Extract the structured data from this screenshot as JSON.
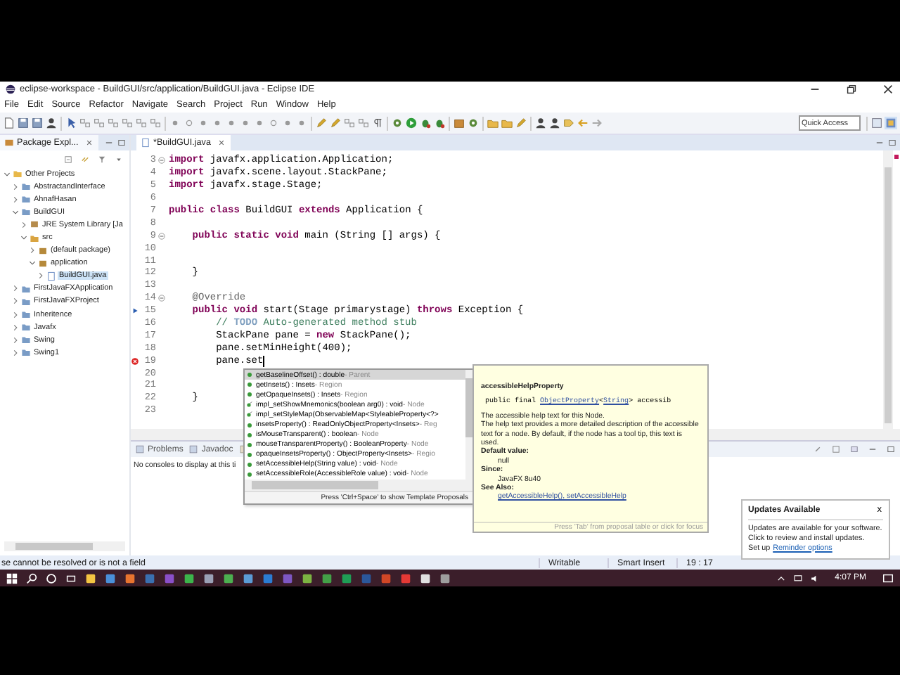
{
  "window": {
    "title": "eclipse-workspace - BuildGUI/src/application/BuildGUI.java - Eclipse IDE"
  },
  "menu": [
    "File",
    "Edit",
    "Source",
    "Refactor",
    "Navigate",
    "Search",
    "Project",
    "Run",
    "Window",
    "Help"
  ],
  "toolbar": {
    "quick_access": {
      "placeholder": "Quick Access"
    }
  },
  "package_explorer": {
    "tab": "Package Expl...",
    "tree": [
      {
        "label": "Other Projects",
        "kind": "folder",
        "expanded": true,
        "selected": false,
        "children": [
          {
            "label": "AbstractandInterface",
            "kind": "project",
            "expanded": false,
            "selected": false
          },
          {
            "label": "AhnafHasan",
            "kind": "project",
            "expanded": false,
            "selected": false
          },
          {
            "label": "BuildGUI",
            "kind": "project",
            "expanded": true,
            "selected": false,
            "children": [
              {
                "label": "JRE System Library [Ja",
                "kind": "library",
                "expanded": false,
                "selected": false
              },
              {
                "label": "src",
                "kind": "source",
                "expanded": true,
                "selected": false,
                "children": [
                  {
                    "label": "(default package)",
                    "kind": "package",
                    "expanded": false,
                    "selected": false
                  },
                  {
                    "label": "application",
                    "kind": "package",
                    "expanded": true,
                    "selected": false,
                    "children": [
                      {
                        "label": "BuildGUI.java",
                        "kind": "file",
                        "expanded": false,
                        "selected": true
                      }
                    ]
                  }
                ]
              }
            ]
          },
          {
            "label": "FirstJavaFXApplication",
            "kind": "project",
            "expanded": false,
            "selected": false
          },
          {
            "label": "FirstJavaFXProject",
            "kind": "project",
            "expanded": false,
            "selected": false
          },
          {
            "label": "Inheritence",
            "kind": "project",
            "expanded": false,
            "selected": false
          },
          {
            "label": "Javafx",
            "kind": "project",
            "expanded": false,
            "selected": false
          },
          {
            "label": "Swing",
            "kind": "project",
            "expanded": false,
            "selected": false
          },
          {
            "label": "Swing1",
            "kind": "project",
            "expanded": false,
            "selected": false
          }
        ]
      }
    ]
  },
  "editor": {
    "tab": "*BuildGUI.java",
    "lines": [
      {
        "number": "3",
        "kind": "fold",
        "segments": [
          {
            "kind": "keyword",
            "text": "import"
          },
          {
            "kind": "plain",
            "text": " javafx.application.Application;"
          }
        ]
      },
      {
        "number": "4",
        "kind": "plain",
        "segments": [
          {
            "kind": "keyword",
            "text": "import"
          },
          {
            "kind": "plain",
            "text": " javafx.scene.layout.StackPane;"
          }
        ]
      },
      {
        "number": "5",
        "kind": "plain",
        "segments": [
          {
            "kind": "keyword",
            "text": "import"
          },
          {
            "kind": "plain",
            "text": " javafx.stage.Stage;"
          }
        ]
      },
      {
        "number": "6",
        "kind": "plain"
      },
      {
        "number": "7",
        "kind": "plain",
        "segments": [
          {
            "kind": "keyword",
            "text": "public"
          },
          {
            "kind": "keyword",
            "text": " class"
          },
          {
            "kind": "plain",
            "text": " BuildGUI "
          },
          {
            "kind": "keyword",
            "text": "extends"
          },
          {
            "kind": "plain",
            "text": " Application {"
          }
        ]
      },
      {
        "number": "8",
        "kind": "plain"
      },
      {
        "number": "9",
        "kind": "fold",
        "segments": [
          {
            "kind": "keyword",
            "text": "    public"
          },
          {
            "kind": "keyword",
            "text": " static"
          },
          {
            "kind": "keyword",
            "text": " void"
          },
          {
            "kind": "plain",
            "text": " main (String [] args) {"
          }
        ]
      },
      {
        "number": "10",
        "kind": "plain"
      },
      {
        "number": "11",
        "kind": "plain"
      },
      {
        "number": "12",
        "kind": "plain",
        "segments": [
          {
            "kind": "plain",
            "text": "    }"
          }
        ]
      },
      {
        "number": "13",
        "kind": "plain"
      },
      {
        "number": "14",
        "kind": "fold",
        "segments": [
          {
            "kind": "annotation",
            "text": "    @Override"
          }
        ]
      },
      {
        "number": "15",
        "kind": "override",
        "segments": [
          {
            "kind": "keyword",
            "text": "    public"
          },
          {
            "kind": "keyword",
            "text": " void"
          },
          {
            "kind": "plain",
            "text": " start(Stage primarystage) "
          },
          {
            "kind": "keyword",
            "text": "throws"
          },
          {
            "kind": "plain",
            "text": " Exception {"
          }
        ]
      },
      {
        "number": "16",
        "kind": "plain",
        "segments": [
          {
            "kind": "comment",
            "text": "        // "
          },
          {
            "kind": "todo",
            "text": "TODO"
          },
          {
            "kind": "comment",
            "text": " Auto-generated method stub"
          }
        ]
      },
      {
        "number": "17",
        "kind": "plain",
        "segments": [
          {
            "kind": "plain",
            "text": "        StackPane pane = "
          },
          {
            "kind": "keyword",
            "text": "new"
          },
          {
            "kind": "plain",
            "text": " StackPane();"
          }
        ]
      },
      {
        "number": "18",
        "kind": "plain",
        "segments": [
          {
            "kind": "plain",
            "text": "        pane.setMinHeight(400);"
          }
        ]
      },
      {
        "number": "19",
        "kind": "error",
        "segments": [
          {
            "kind": "plain",
            "text": "        pane.set"
          }
        ]
      },
      {
        "number": "20",
        "kind": "plain"
      },
      {
        "number": "21",
        "kind": "plain"
      },
      {
        "number": "22",
        "kind": "plain",
        "segments": [
          {
            "kind": "plain",
            "text": "    }"
          }
        ]
      },
      {
        "number": "23",
        "kind": "plain"
      }
    ]
  },
  "console": {
    "tabs": [
      {
        "label": "Problems",
        "selected": false
      },
      {
        "label": "Javadoc",
        "selected": false
      }
    ],
    "message": "No consoles to display at this ti"
  },
  "completion": {
    "items": [
      {
        "signature": "getBaselineOffset() : double",
        "owner": " - Parent",
        "kind": "method",
        "selected": true
      },
      {
        "signature": "getInsets() : Insets",
        "owner": " - Region",
        "kind": "method",
        "selected": false
      },
      {
        "signature": "getOpaqueInsets() : Insets",
        "owner": " - Region",
        "kind": "method",
        "selected": false
      },
      {
        "signature": "impl_setShowMnemonics(boolean arg0) : void",
        "owner": " - Node",
        "kind": "deprecated",
        "selected": false
      },
      {
        "signature": "impl_setStyleMap(ObservableMap<StyleableProperty<?>",
        "kind": "deprecated",
        "selected": false
      },
      {
        "signature": "insetsProperty() : ReadOnlyObjectProperty<Insets>",
        "owner": " - Reg",
        "kind": "method",
        "selected": false
      },
      {
        "signature": "isMouseTransparent() : boolean",
        "owner": " - Node",
        "kind": "method",
        "selected": false
      },
      {
        "signature": "mouseTransparentProperty() : BooleanProperty",
        "owner": " - Node",
        "kind": "method",
        "selected": false
      },
      {
        "signature": "opaqueInsetsProperty() : ObjectProperty<Insets>",
        "owner": " - Regio",
        "kind": "method",
        "selected": false
      },
      {
        "signature": "setAccessibleHelp(String value) : void",
        "owner": " - Node",
        "kind": "method",
        "selected": false
      },
      {
        "signature": "setAccessibleRole(AccessibleRole value) : void",
        "owner": " - Node",
        "kind": "method",
        "selected": false
      }
    ],
    "footer": "Press 'Ctrl+Space' to show Template Proposals"
  },
  "javadoc": {
    "title": "accessibleHelpProperty",
    "signature": [
      {
        "kind": "plain",
        "text": "public final "
      },
      {
        "kind": "link",
        "text": "ObjectProperty"
      },
      {
        "kind": "plain",
        "text": "<"
      },
      {
        "kind": "link",
        "text": "String"
      },
      {
        "kind": "plain",
        "text": "> accessib"
      }
    ],
    "description": [
      "The accessible help text for this Node.",
      "The help text provides a more detailed description of the accessible text for a node. By default, if the node has a tool tip, this text is used."
    ],
    "sections": [
      {
        "heading": "Default value:",
        "value": "null",
        "kind": "text"
      },
      {
        "heading": "Since:",
        "value": "JavaFX 8u40",
        "kind": "text"
      },
      {
        "heading": "See Also:",
        "value": "getAccessibleHelp(), setAccessibleHelp",
        "kind": "link"
      }
    ],
    "footer": "Press 'Tab' from proposal table or click for focus"
  },
  "status_bar": {
    "message": "se cannot be resolved or is not a field",
    "mode": "Writable",
    "insert": "Smart Insert",
    "position": "19 : 17"
  },
  "notification": {
    "title": "Updates Available",
    "close": "x",
    "lines": [
      "Updates are available for your software.",
      "Click to review and install updates."
    ],
    "prefix": "Set up",
    "link": "Reminder options"
  },
  "taskbar": {
    "time": "4:07 PM"
  }
}
